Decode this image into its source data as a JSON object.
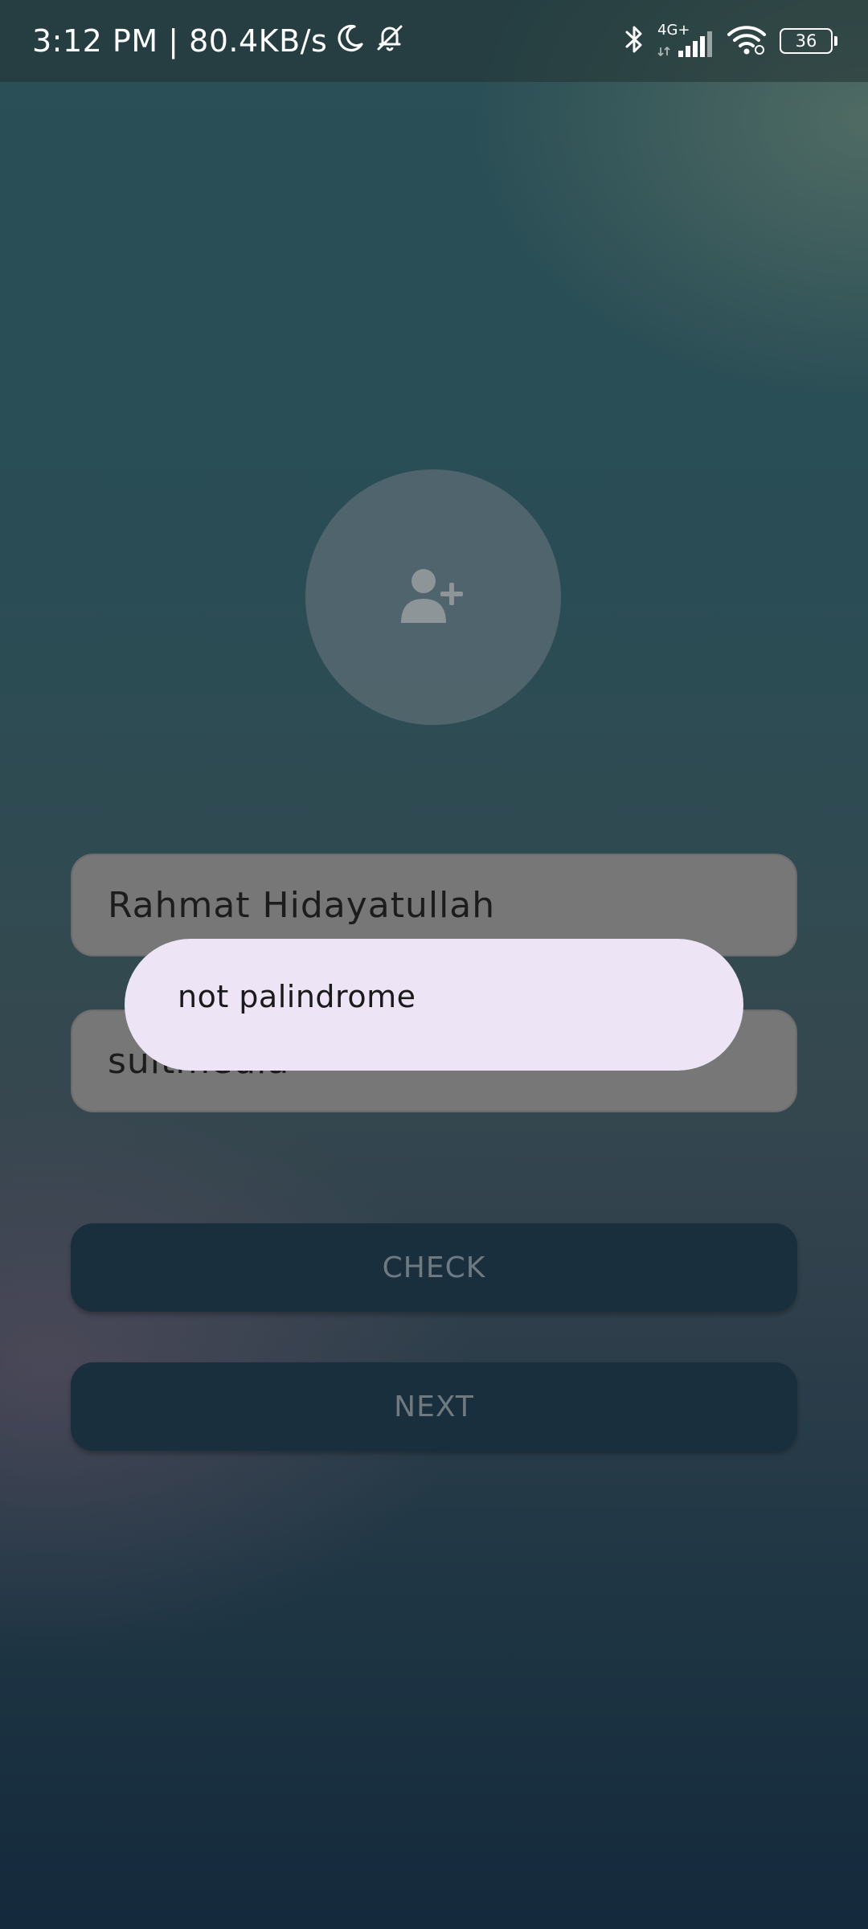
{
  "status_bar": {
    "time_speed": "3:12 PM | 80.4KB/s",
    "network_label": "4G+",
    "battery_level": "36",
    "icons": [
      "moon-icon",
      "bell-off-icon",
      "bluetooth-icon",
      "signal-icon",
      "wifi-icon",
      "battery-icon"
    ]
  },
  "avatar": {
    "icon": "add-person-icon"
  },
  "form": {
    "name_value": "Rahmat Hidayatullah",
    "sentence_value": "suitmedia"
  },
  "buttons": {
    "check_label": "CHECK",
    "next_label": "NEXT"
  },
  "toast": {
    "message": "not palindrome"
  },
  "colors": {
    "field_bg": "#777777",
    "button_bg": "#1a2f3d",
    "toast_bg": "#ede4f6"
  }
}
